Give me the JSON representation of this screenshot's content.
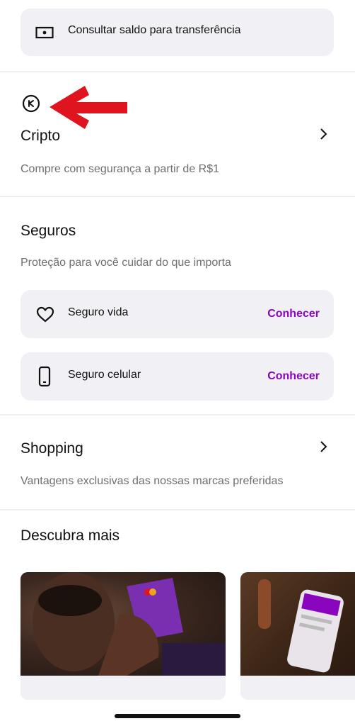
{
  "transfer": {
    "label": "Consultar saldo para transferência",
    "icon": "cash-icon"
  },
  "crypto": {
    "icon": "crypto-coin-icon",
    "title": "Cripto",
    "subtitle": "Compre com segurança a partir de R$1",
    "annotation_color": "#e0141e"
  },
  "insurance": {
    "title": "Seguros",
    "subtitle": "Proteção para você cuidar do que importa",
    "items": [
      {
        "label": "Seguro vida",
        "action": "Conhecer",
        "icon": "heart-icon"
      },
      {
        "label": "Seguro celular",
        "action": "Conhecer",
        "icon": "phone-icon"
      }
    ]
  },
  "shopping": {
    "title": "Shopping",
    "subtitle": "Vantagens exclusivas das nossas marcas preferidas"
  },
  "discover": {
    "title": "Descubra mais",
    "cards": [
      {
        "image": "person-with-card-photo"
      },
      {
        "image": "phone-app-photo"
      }
    ]
  },
  "colors": {
    "accent": "#8a05be",
    "card_bg": "#f0f0f5",
    "muted_text": "#6e6e73"
  }
}
